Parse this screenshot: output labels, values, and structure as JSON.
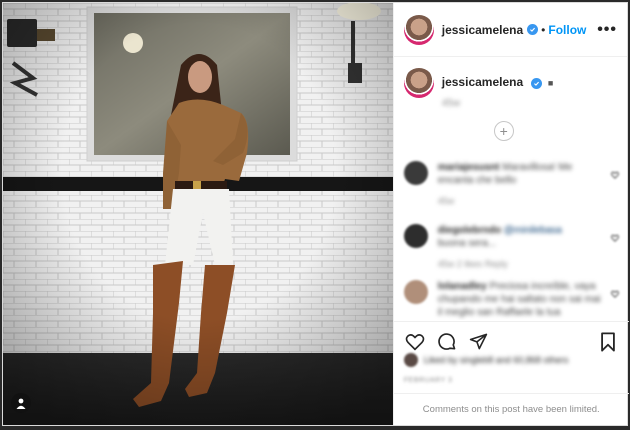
{
  "author": {
    "username": "jessicamelena",
    "verified": true,
    "follow_label": "Follow",
    "separator": "•",
    "more_label": "•••"
  },
  "caption": {
    "username": "jessicamelena",
    "emoji": "■",
    "time": "45w"
  },
  "load_more_label": "+",
  "comments": [
    {
      "username": "mariajesusnt",
      "text": "Maravillosa! Me encanta che bello",
      "meta": "45w",
      "avatar_color": "#3a3a3a"
    },
    {
      "username": "diegolebrndo",
      "mention": "@minilebasa",
      "text": "buona sera...",
      "meta": "45w   2 likes   Reply",
      "avatar_color": "#2d2d2d"
    },
    {
      "username": "lolanadley",
      "text": "Preciosa increíble, vaya chupando me hai saltato non sai mai il meglio san Raffaele la tua",
      "meta": "",
      "avatar_color": "#b08f7a"
    }
  ],
  "actions": {
    "like": "heart-icon",
    "comment": "comment-icon",
    "share": "share-icon",
    "save": "bookmark-icon"
  },
  "likes_text": "Liked by singleb8 and 60,868 others",
  "post_date": "FEBRUARY 3",
  "limited_text": "Comments on this post have been limited.",
  "colors": {
    "link_blue": "#0095f6",
    "verified_blue": "#3897f0",
    "text": "#262626",
    "muted": "#8e8e8e"
  }
}
